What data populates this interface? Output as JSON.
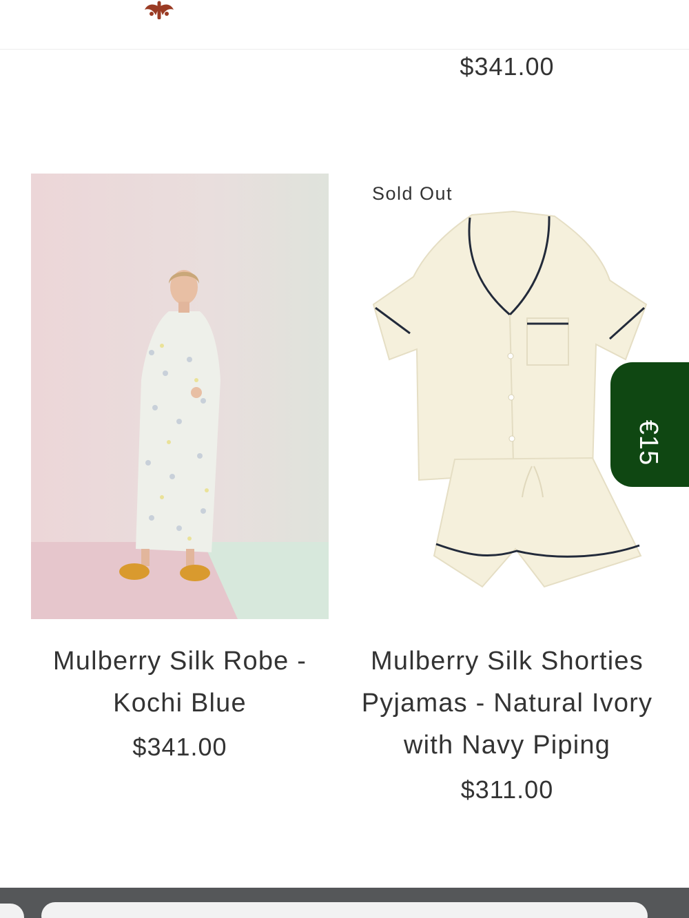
{
  "header": {
    "logo": "brand-logo"
  },
  "top_product": {
    "price": "$341.00"
  },
  "products": [
    {
      "title": "Mulberry Silk Robe - Kochi Blue",
      "price": "$341.00",
      "badge": ""
    },
    {
      "title": "Mulberry Silk Shorties Pyjamas - Natural Ivory with Navy Piping",
      "price": "$311.00",
      "badge": "Sold Out"
    }
  ],
  "promo": {
    "label": "€15",
    "color": "#0f4712"
  },
  "colors": {
    "text": "#333333",
    "logo": "#9a3b24",
    "bottom_bar": "#555759"
  }
}
